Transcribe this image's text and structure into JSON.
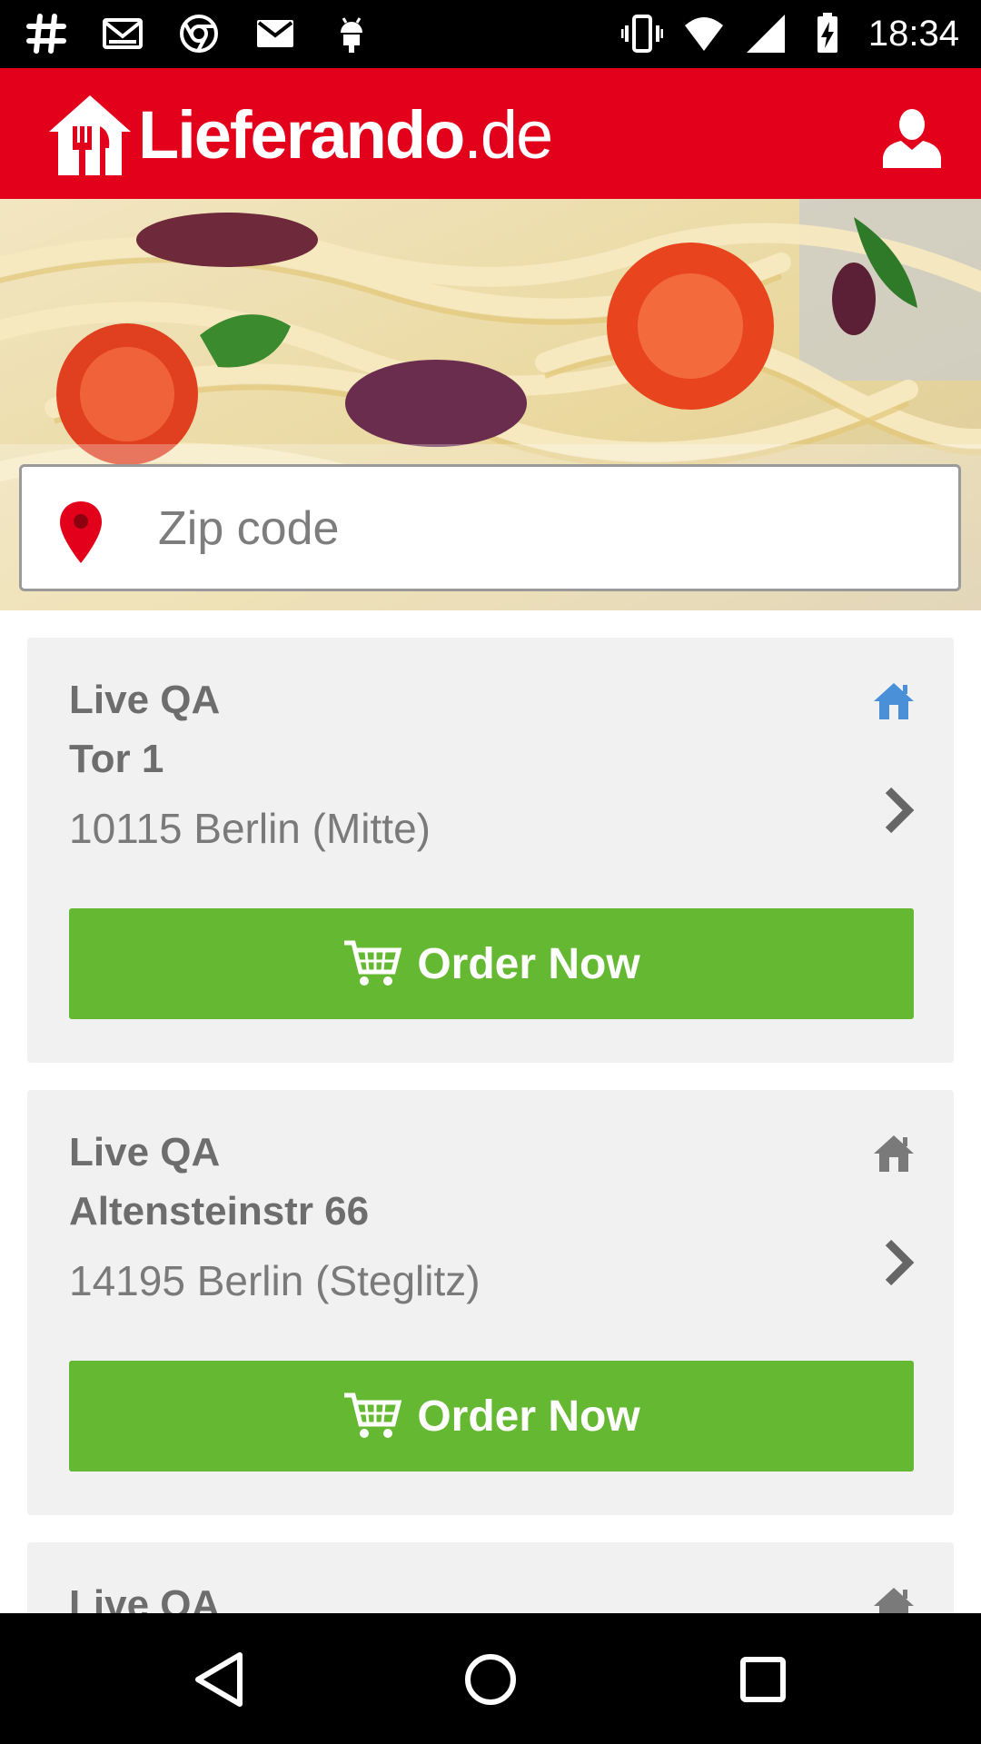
{
  "status_bar": {
    "time": "18:34",
    "left_icons": [
      "hashtag-icon",
      "gmail-icon",
      "chrome-icon",
      "mail-icon",
      "android-icon"
    ],
    "right_icons": [
      "vibrate-icon",
      "wifi-icon",
      "signal-icon",
      "battery-charging-icon"
    ]
  },
  "header": {
    "logo_main": "Lieferando",
    "logo_tld": ".de",
    "brand_color": "#e2001a"
  },
  "search": {
    "placeholder": "Zip code",
    "value": ""
  },
  "restaurants": [
    {
      "name": "Live QA",
      "street": "Tor 1",
      "address": "10115 Berlin (Mitte)",
      "order_label": "Order Now",
      "home_icon_color": "#4a90d9"
    },
    {
      "name": "Live QA",
      "street": "Altensteinstr 66",
      "address": "14195 Berlin (Steglitz)",
      "order_label": "Order Now",
      "home_icon_color": "#7a7a7a"
    },
    {
      "name": "Live QA",
      "street": "",
      "address": "",
      "order_label": "",
      "home_icon_color": "#7a7a7a"
    }
  ],
  "colors": {
    "order_button": "#65b832",
    "card_background": "#f1f1f1"
  }
}
